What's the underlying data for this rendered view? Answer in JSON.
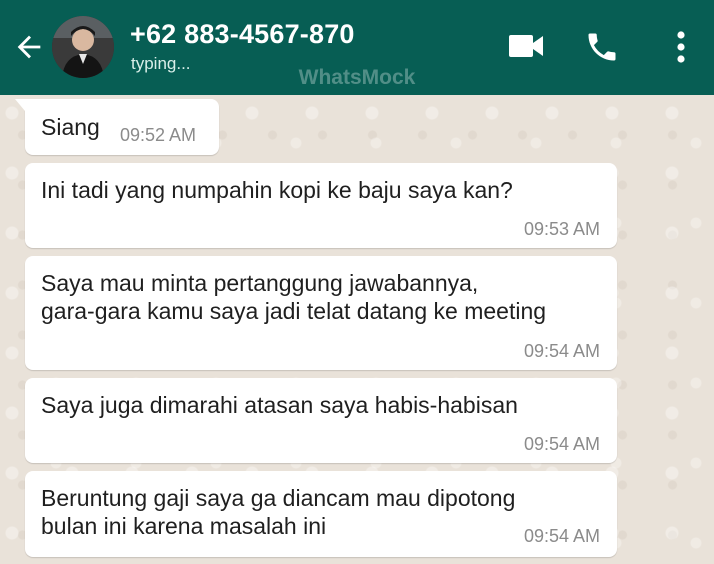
{
  "header": {
    "contact_name": "+62 883-4567-870",
    "status": "typing...",
    "watermark": "WhatsMock",
    "color": "#075E54",
    "icons": [
      "back-arrow-icon",
      "video-call-icon",
      "phone-icon",
      "more-vert-icon"
    ]
  },
  "messages": [
    {
      "text": "Siang",
      "time": "09:52 AM",
      "direction": "incoming"
    },
    {
      "text": "Ini tadi yang numpahin kopi ke baju saya kan?",
      "time": "09:53 AM",
      "direction": "incoming"
    },
    {
      "text": "Saya mau minta pertanggung jawabannya,\ngara-gara kamu saya jadi telat datang ke meeting",
      "time": "09:54 AM",
      "direction": "incoming"
    },
    {
      "text": "Saya juga dimarahi atasan saya habis-habisan",
      "time": "09:54 AM",
      "direction": "incoming"
    },
    {
      "text": "Beruntung gaji saya ga diancam mau dipotong\nbulan ini karena masalah ini",
      "time": "09:54 AM",
      "direction": "incoming"
    }
  ],
  "colors": {
    "bubble_bg": "#FFFFFF",
    "chat_bg": "#E9E2D9",
    "timestamp": "#8B8B8B"
  }
}
